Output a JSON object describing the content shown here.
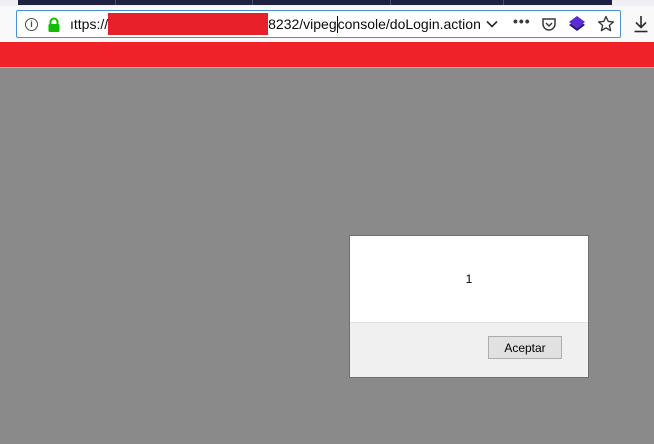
{
  "browser": {
    "url_prefix": "ıttps://",
    "url_suffix": "8232/vipeg",
    "url_tail": "console/doLogin.action",
    "more_label": "•••",
    "info_label": "i"
  },
  "dialog": {
    "message": "1",
    "ok_label": "Aceptar"
  },
  "colors": {
    "page_banner": "#ef2229",
    "redaction": "#e8202a",
    "backdrop": "#8a8a8a"
  },
  "icons": [
    "info-icon",
    "lock-icon",
    "chevron-down-icon",
    "more-icon",
    "pocket-icon",
    "layers-icon",
    "star-icon",
    "download-icon"
  ]
}
